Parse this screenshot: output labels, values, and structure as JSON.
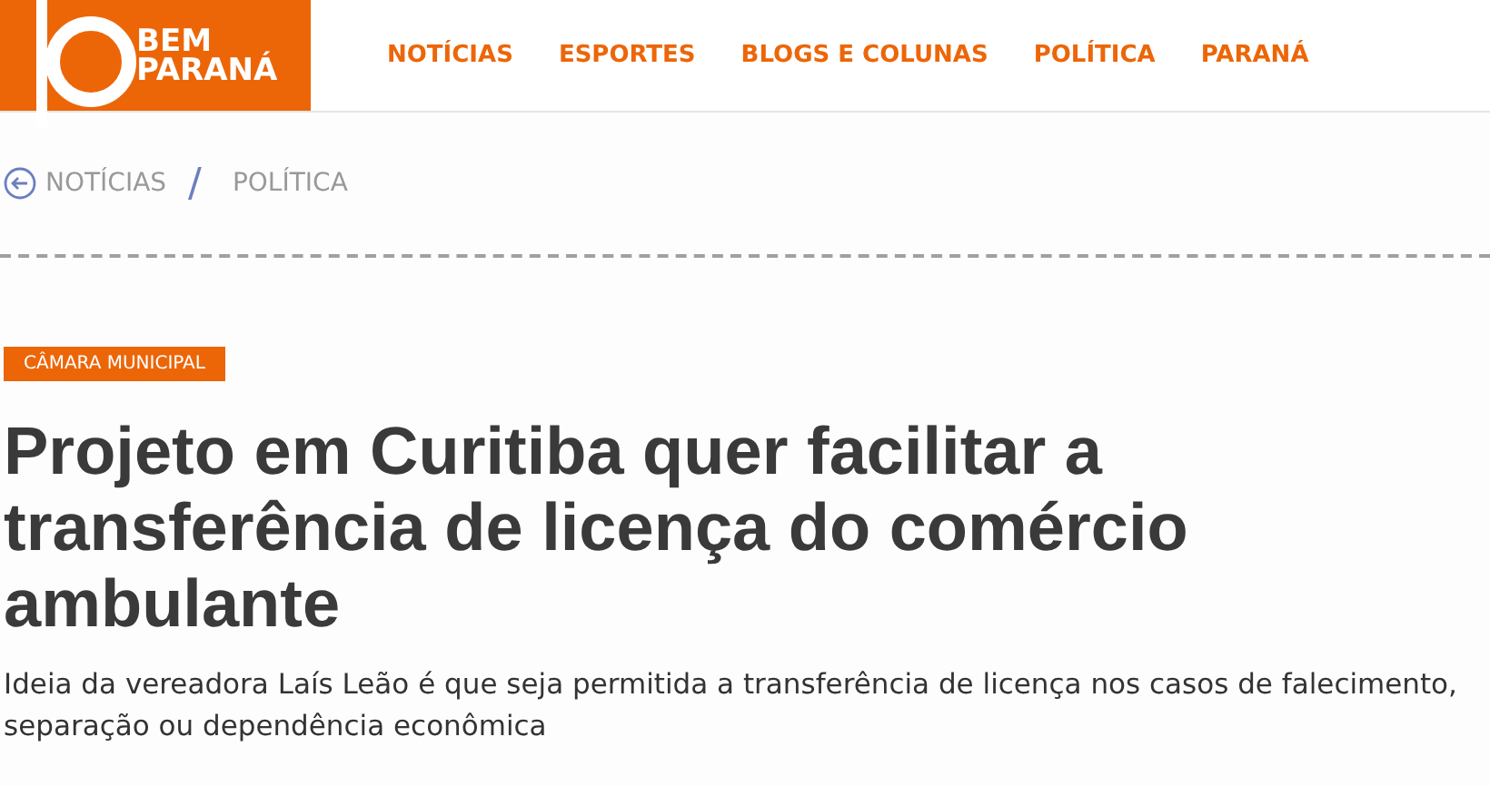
{
  "logo": {
    "line_1": "BEM",
    "line_2": "PARANÁ"
  },
  "nav": [
    "NOTÍCIAS",
    "ESPORTES",
    "BLOGS E COLUNAS",
    "POLÍTICA",
    "PARANÁ"
  ],
  "breadcrumb": {
    "parent": "NOTÍCIAS",
    "separator": "/",
    "current": "POLÍTICA"
  },
  "article": {
    "tag": "CÂMARA MUNICIPAL",
    "headline": "Projeto em Curitiba quer facilitar a transferência de licença do comércio ambulante",
    "summary": "Ideia da vereadora Laís Leão é que seja permitida a transferência de licença nos casos de falecimento, separação ou dependência econômica"
  }
}
